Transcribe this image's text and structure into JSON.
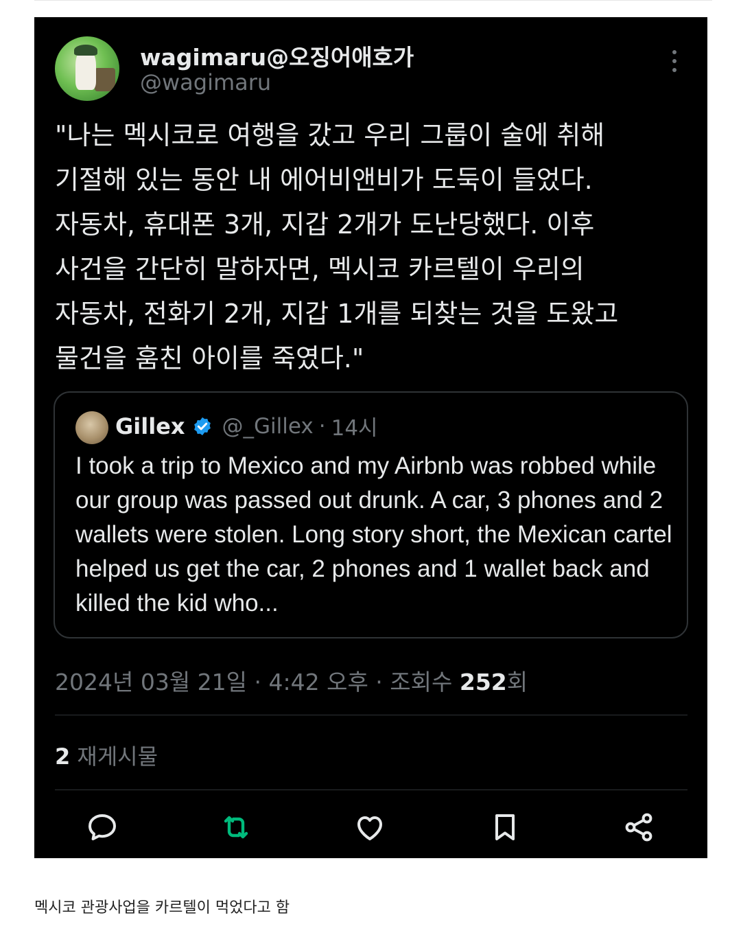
{
  "tweet": {
    "display_name": "wagimaru@오징어애호가",
    "handle": "@wagimaru",
    "text": "\"나는 멕시코로 여행을 갔고 우리 그룹이 술에 취해\n기절해 있는 동안 내 에어비앤비가 도둑이 들었다.\n자동차, 휴대폰 3개, 지갑 2개가 도난당했다. 이후\n사건을 간단히 말하자면, 멕시코 카르텔이 우리의\n자동차, 전화기 2개, 지갑 1개를 되찾는 것을 도왔고\n물건을 훔친 아이를 죽였다.\"",
    "date": "2024년 03월 21일 · 4:42 오후 · 조회수 ",
    "views_count": "252",
    "views_suffix": "회",
    "reposts_count": "2",
    "reposts_label": "재게시물"
  },
  "quote": {
    "name": "Gillex",
    "handle": "@_Gillex",
    "separator": "·",
    "time": "14시",
    "text": "I took a trip to Mexico and my Airbnb was robbed while our group was passed out drunk. A car, 3 phones and 2 wallets were stolen. Long story short, the Mexican cartel helped us get the car, 2 phones and 1 wallet back and killed the kid who..."
  },
  "actions": {
    "reply_icon": "reply-icon",
    "repost_icon": "repost-icon",
    "like_icon": "like-icon",
    "bookmark_icon": "bookmark-icon",
    "share_icon": "share-icon"
  },
  "colors": {
    "background": "#000000",
    "text": "#e7e9ea",
    "muted": "#71767b",
    "repost_active": "#00ba7c",
    "verified": "#1d9bf0"
  },
  "caption": "멕시코 관광사업을 카르텔이 먹었다고 함"
}
